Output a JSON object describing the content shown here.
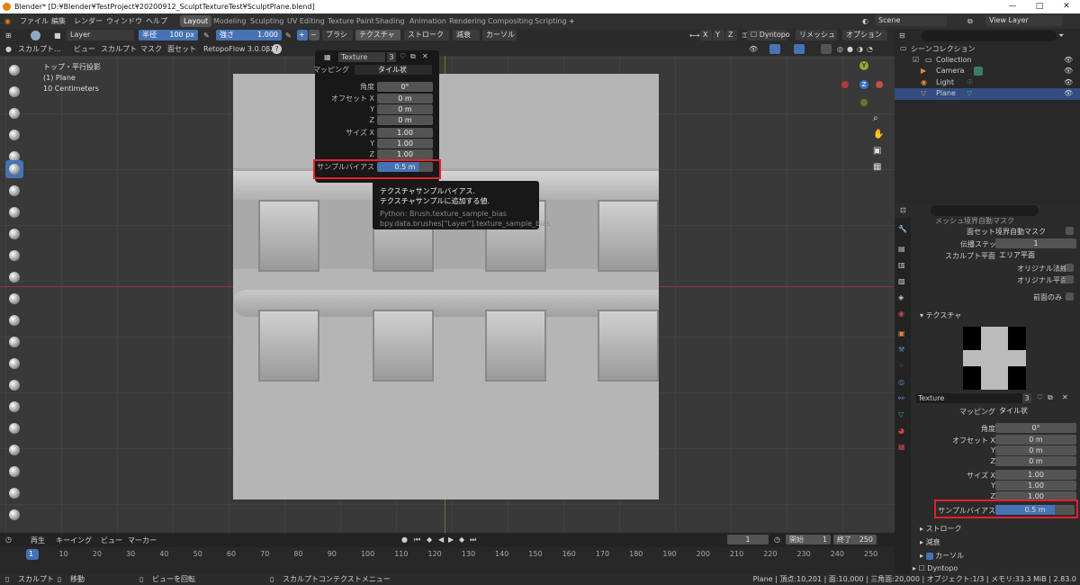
{
  "window": {
    "title": "Blender* [D:¥Blender¥TestProject¥20200912_SculptTextureTest¥SculptPlane.blend]",
    "min": "—",
    "max": "□",
    "close": "✕"
  },
  "menu": [
    "ファイル",
    "編集",
    "レンダー",
    "ウィンドウ",
    "ヘルプ"
  ],
  "workspaces": [
    "Layout",
    "Modeling",
    "Sculpting",
    "UV Editing",
    "Texture Paint",
    "Shading",
    "Animation",
    "Rendering",
    "Compositing",
    "Scripting"
  ],
  "scene": "Scene",
  "view_layer": "View Layer",
  "header": {
    "layer": "Layer",
    "radius_label": "半径",
    "radius_value": "100 px",
    "strength_label": "強さ",
    "strength_value": "1.000",
    "plus": "+",
    "minus": "−",
    "dropdowns": [
      "ブラシ",
      "テクスチャ",
      "ストローク",
      "減衰",
      "カーソル"
    ],
    "axes": [
      "X",
      "Y",
      "Z"
    ],
    "dyntopo": "Dyntopo",
    "remesh": "リメッシュ",
    "options": "オプション"
  },
  "toolheader": {
    "mode": "スカルプト…",
    "items": [
      "ビュー",
      "スカルプト",
      "マスク",
      "面セット"
    ],
    "addon": "RetopoFlow 3.0.0β2",
    "help": "?"
  },
  "overlay": {
    "line1": "トップ・平行投影",
    "line2": "(1) Plane",
    "line3": "10 Centimeters"
  },
  "gizmo": {
    "y": "Y",
    "z": "Z"
  },
  "popup": {
    "texture_name": "Texture",
    "texture_users": "3",
    "mapping_label": "マッピング",
    "mapping_value": "タイル状",
    "angle_label": "角度",
    "angle_value": "0°",
    "offset_x_label": "オフセット X",
    "offset_x": "0 m",
    "y_label": "Y",
    "offset_y": "0 m",
    "z_label": "Z",
    "offset_z": "0 m",
    "size_x_label": "サイズ X",
    "size_x": "1.00",
    "size_y": "1.00",
    "size_z": "1.00",
    "bias_label": "サンプルバイアス",
    "bias_value": "0.5 m"
  },
  "tooltip": {
    "line1": "テクスチャサンプルバイアス.",
    "line2": "テクスチャサンプルに追加する値.",
    "python1": "Python: Brush.texture_sample_bias",
    "python2": "bpy.data.brushes[\"Layer\"].texture_sample_bias"
  },
  "outliner": {
    "header": "シーンコレクション",
    "items": [
      "Collection",
      "Camera",
      "Light",
      "Plane"
    ]
  },
  "props": {
    "cut_row": "メッシュ境界自動マスク",
    "faceset_mask": "面セット境界自動マスク",
    "propagation_label": "伝播ステップ",
    "propagation_value": "1",
    "sculpt_plane_label": "スカルプト平面",
    "sculpt_plane_value": "エリア平面",
    "original_normal": "オリジナル法線",
    "original_plane": "オリジナル平面",
    "front_only": "前面のみ",
    "texture_section": "テクスチャ",
    "texture_name": "Texture",
    "texture_users": "3",
    "mapping_label": "マッピング",
    "mapping_value": "タイル状",
    "angle_label": "角度",
    "angle_value": "0°",
    "offset_x_label": "オフセット X",
    "offset_x": "0 m",
    "y_label": "Y",
    "offset_y": "0 m",
    "z_label": "Z",
    "offset_z": "0 m",
    "size_x_label": "サイズ X",
    "size_x": "1.00",
    "size_y": "1.00",
    "size_z": "1.00",
    "bias_label": "サンプルバイアス",
    "bias_value": "0.5 m",
    "stroke_section": "ストローク",
    "falloff_section": "減衰",
    "cursor_section": "カーソル",
    "dyntopo_section": "Dyntopo"
  },
  "timeline": {
    "menus": [
      "再生",
      "キーイング",
      "ビュー",
      "マーカー"
    ],
    "current_frame": "1",
    "start_label": "開始",
    "start": "1",
    "end_label": "終了",
    "end": "250",
    "ticks": [
      "1",
      "10",
      "20",
      "30",
      "40",
      "50",
      "60",
      "70",
      "80",
      "90",
      "100",
      "110",
      "120",
      "130",
      "140",
      "150",
      "160",
      "170",
      "180",
      "190",
      "200",
      "210",
      "220",
      "230",
      "240",
      "250"
    ]
  },
  "status": {
    "left1": "スカルプト",
    "left2": "移動",
    "mid1": "ビューを回転",
    "mid2": "スカルプトコンテクストメニュー",
    "right": "Plane | 頂点:10,201 | 面:10,000 | 三角面:20,000 | オブジェクト:1/3 | メモリ:33.3 MiB | 2.83.0"
  },
  "colors": {
    "accent": "#4772b3",
    "highlight": "#e3212f",
    "bg": "#393939"
  }
}
